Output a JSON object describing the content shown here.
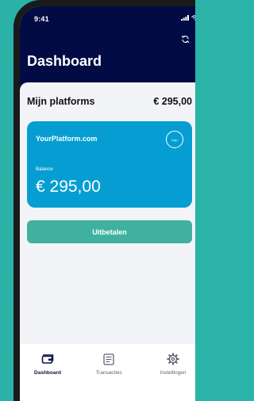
{
  "status_bar": {
    "time": "9:41",
    "icons": [
      "signal-icon",
      "wifi-icon",
      "battery-icon"
    ]
  },
  "header": {
    "title": "Dashboard",
    "refresh_icon": "refresh-icon"
  },
  "platforms": {
    "title": "Mijn platforms",
    "total": "€ 295,00"
  },
  "platform_card": {
    "name": "YourPlatform.com",
    "logo_text": "logo",
    "balance_label": "Balance",
    "balance_value": "€ 295,00",
    "color": "#069ed2"
  },
  "payout_button": {
    "label": "Uitbetalen",
    "color": "#40b19e"
  },
  "tabbar": {
    "items": [
      {
        "label": "Dashboard",
        "icon": "wallet-icon",
        "active": true
      },
      {
        "label": "Transacties",
        "icon": "receipt-icon",
        "active": false
      },
      {
        "label": "Instellingen",
        "icon": "gear-icon",
        "active": false
      }
    ]
  },
  "colors": {
    "header_bg": "#020b44",
    "background": "#f3f4f8",
    "accent": "#2bb3a8"
  }
}
